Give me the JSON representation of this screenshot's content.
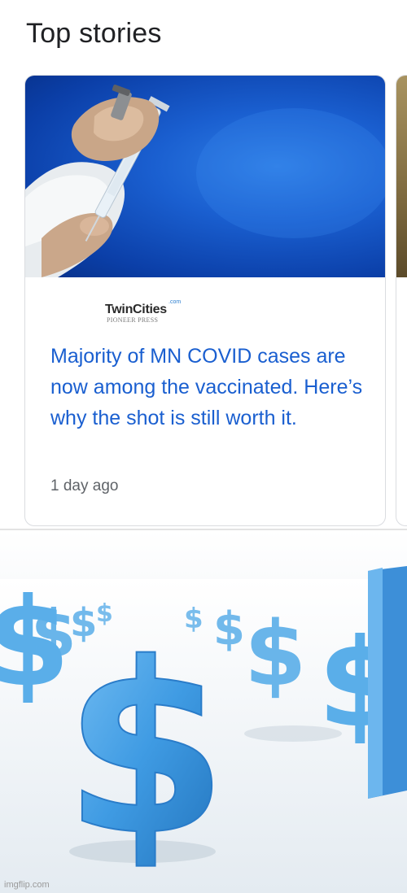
{
  "section": {
    "title": "Top stories"
  },
  "story": {
    "publisher": {
      "name": "TwinCities",
      "name_suffix": ".com",
      "sub": "PIONEER PRESS"
    },
    "headline": "Majority of MN COVID cases are now among the vaccinated. Here’s why the shot is still worth it.",
    "time": "1 day ago",
    "thumbnail": "vaccine-syringe-image"
  },
  "bottom_image": {
    "subject": "dollar-signs-image",
    "glyph": "$",
    "watermark": "imgflip.com"
  },
  "colors": {
    "headline_link": "#1a5fd0",
    "title_text": "#202124",
    "secondary_text": "#5f6368",
    "card_border": "#dadce0",
    "dollar_blue": "#4aa3e6"
  }
}
